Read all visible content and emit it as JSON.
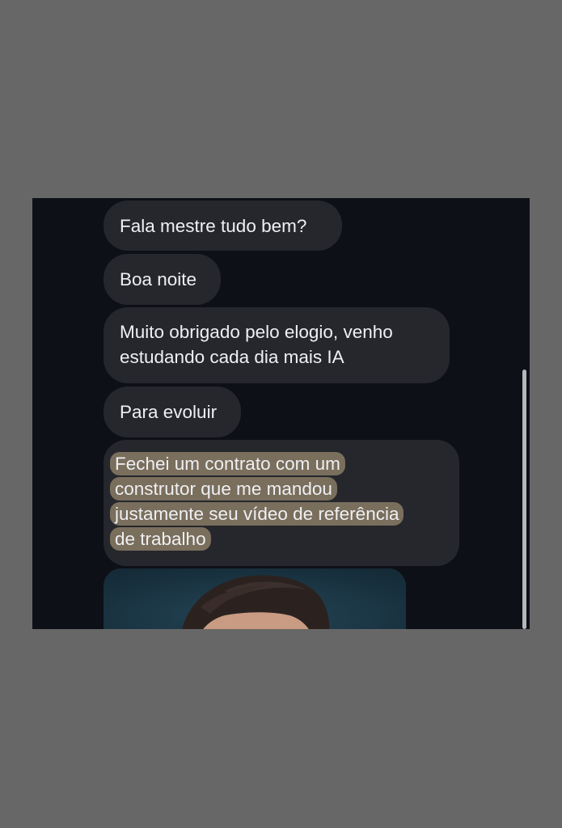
{
  "conversation": {
    "messages": [
      {
        "text": "Fala mestre tudo bem?"
      },
      {
        "text": "Boa noite"
      },
      {
        "lines": [
          "Muito obrigado pelo elogio, venho",
          "estudando cada dia mais IA"
        ]
      },
      {
        "text": "Para evoluir"
      },
      {
        "highlighted_lines": [
          "Fechei um contrato com um",
          "construtor que me mandou",
          "justamente seu vídeo de referência",
          "de trabalho"
        ]
      }
    ],
    "attachment": {
      "icon": "person-photo-icon"
    }
  },
  "colors": {
    "page_background": "#676767",
    "chat_background": "#0d1016",
    "bubble": "#25272c",
    "text": "#eef0f3",
    "highlight": "#7a6e5d"
  }
}
